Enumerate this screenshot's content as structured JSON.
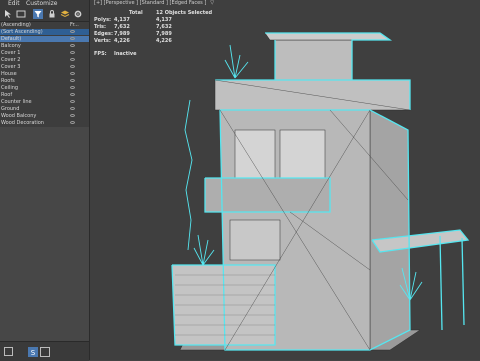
{
  "menu": {
    "edit": "Edit",
    "customize": "Customize"
  },
  "explorer": {
    "header": "(Ascending)",
    "column_hint": "Fr...",
    "rows": [
      {
        "label": "(Sort Ascending)"
      },
      {
        "label": "Default)",
        "state": "selected"
      },
      {
        "label": "Balcony"
      },
      {
        "label": "Cover 1"
      },
      {
        "label": "Cover 2"
      },
      {
        "label": "Cover 3"
      },
      {
        "label": "House"
      },
      {
        "label": "Roofs"
      },
      {
        "label": "Ceiling"
      },
      {
        "label": "Roof"
      },
      {
        "label": "Counter line"
      },
      {
        "label": "Ground"
      },
      {
        "label": "Wood Balcony"
      },
      {
        "label": "Wood Decoration"
      }
    ]
  },
  "viewport": {
    "label": "[+] [Perspective ] [Standard ] [Edged Faces ]",
    "filter_glyph": "▽"
  },
  "stats": {
    "col_total": "Total",
    "col_selected": "12 Objects Selected",
    "rows": [
      {
        "name": "Polys:",
        "total": "4,137",
        "selected": "4,137"
      },
      {
        "name": "Tris:",
        "total": "7,632",
        "selected": "7,632"
      },
      {
        "name": "Edges:",
        "total": "7,989",
        "selected": "7,989"
      },
      {
        "name": "Verts:",
        "total": "4,226",
        "selected": "4,226"
      }
    ],
    "fps_label": "FPS:",
    "fps_value": "Inactive"
  },
  "colors": {
    "wire_highlight": "#55e6f0",
    "wire_edge": "#2e2e2e",
    "face": "#b4b4b4",
    "selection": "#4a78b0"
  },
  "icons": [
    "select-icon",
    "filter-icon",
    "lock-icon",
    "layer-icon",
    "settings-icon"
  ]
}
